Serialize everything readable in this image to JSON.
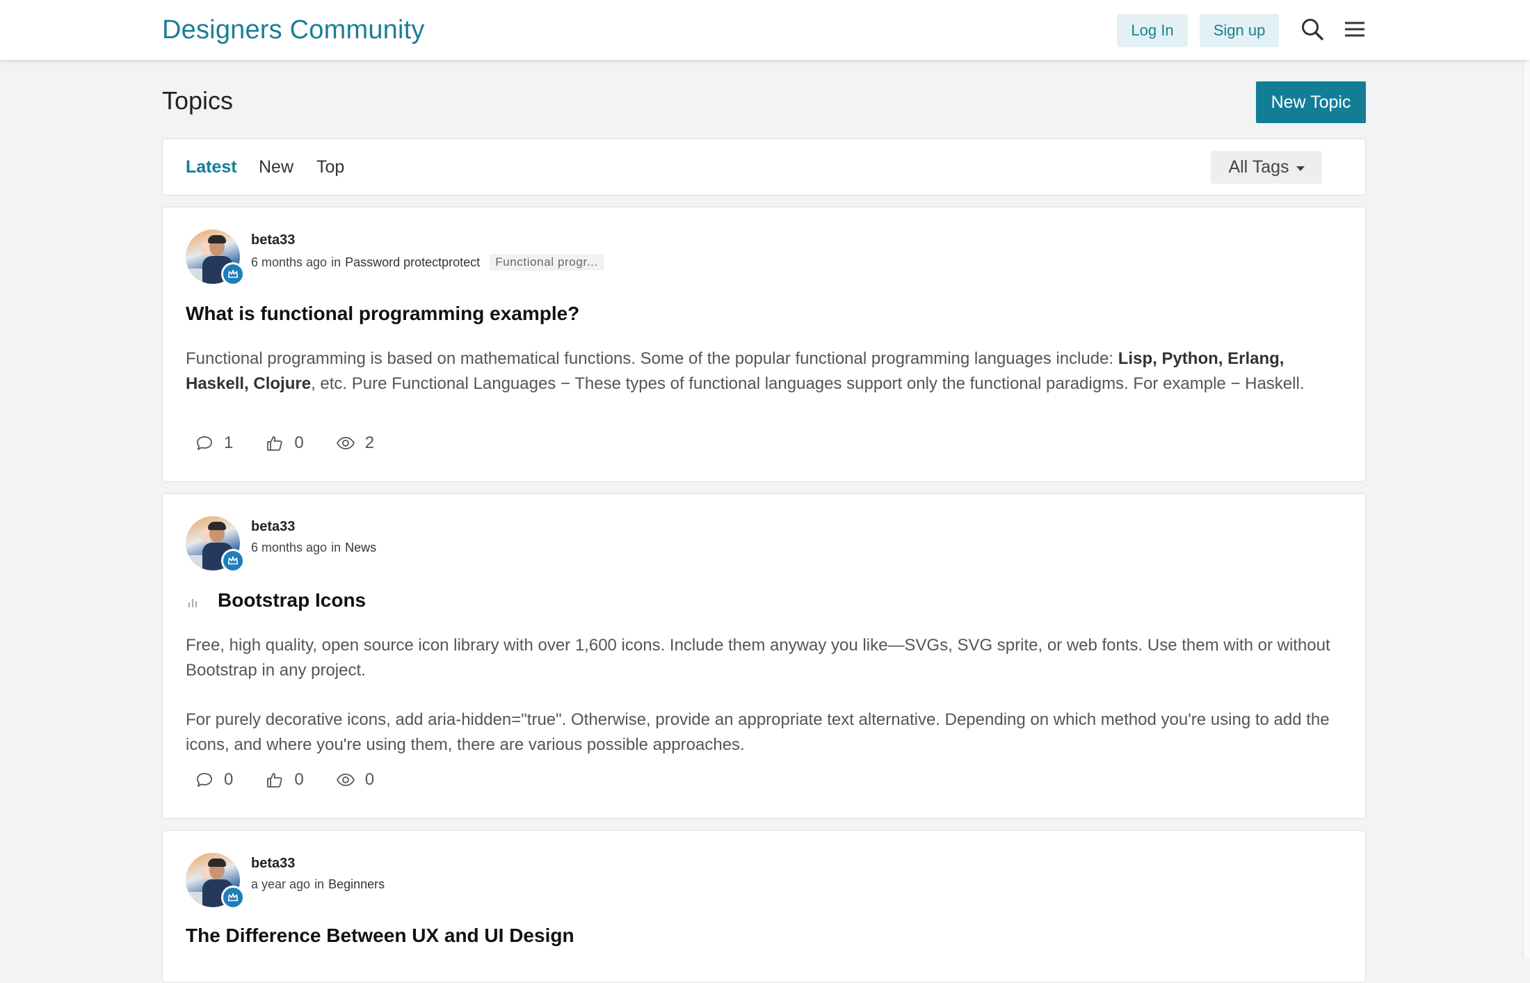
{
  "header": {
    "brand": "Designers Community",
    "login_label": "Log In",
    "signup_label": "Sign up",
    "icons": [
      "search-icon",
      "menu-icon"
    ]
  },
  "page": {
    "title": "Topics",
    "new_topic_label": "New Topic"
  },
  "filters": {
    "tabs": [
      {
        "label": "Latest",
        "active": true
      },
      {
        "label": "New",
        "active": false
      },
      {
        "label": "Top",
        "active": false
      }
    ],
    "tags_label": "All Tags"
  },
  "topics": [
    {
      "author": "beta33",
      "time": "6 months ago",
      "in_label": "in",
      "category": "Password protectprotect",
      "tag": "Functional progr...",
      "title": "What is functional programming example?",
      "excerpt_parts": [
        "Functional programming is based on mathematical functions. Some of the popular functional programming languages include: ",
        "Lisp, Python, Erlang, Haskell, Clojure",
        ", etc. Pure Functional Languages − These types of functional languages support only the functional paradigms. For example − Haskell."
      ],
      "comments": "1",
      "likes": "0",
      "views": "2"
    },
    {
      "author": "beta33",
      "time": "6 months ago",
      "in_label": "in",
      "category": "News",
      "title": "Bootstrap Icons",
      "excerpt_p1": "Free, high quality, open source icon library with over 1,600 icons. Include them anyway you like—SVGs, SVG sprite, or web fonts. Use them with or without Bootstrap in any project.",
      "excerpt_p2": "For purely decorative icons, add aria-hidden=\"true\". Otherwise, provide an appropriate text alternative. Depending on which method you're using to add the icons, and where you're using them, there are various possible approaches.",
      "comments": "0",
      "likes": "0",
      "views": "0"
    },
    {
      "author": "beta33",
      "time": "a year ago",
      "in_label": "in",
      "category": "Beginners",
      "title": "The Difference Between UX and UI Design"
    }
  ],
  "colors": {
    "brand": "#1a7f96",
    "primary_button": "#117e96",
    "light_button": "#e3f1f4",
    "background": "#f1f3f4"
  }
}
